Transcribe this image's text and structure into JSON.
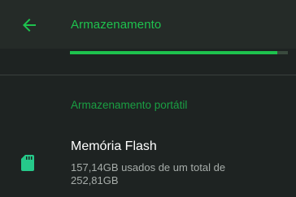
{
  "appbar": {
    "back_icon": "arrow-left-icon",
    "title": "Armazenamento"
  },
  "usage": {
    "fraction_used": 0.95
  },
  "sections": {
    "portable": {
      "header": "Armazenamento portátil",
      "items": [
        {
          "icon": "sd-card-icon",
          "title": "Memória Flash",
          "subtitle": "157,14GB usados de um total de 252,81GB"
        }
      ]
    }
  },
  "colors": {
    "accent": "#1ec24e",
    "background": "#1e2322",
    "appbar": "#252b28"
  }
}
